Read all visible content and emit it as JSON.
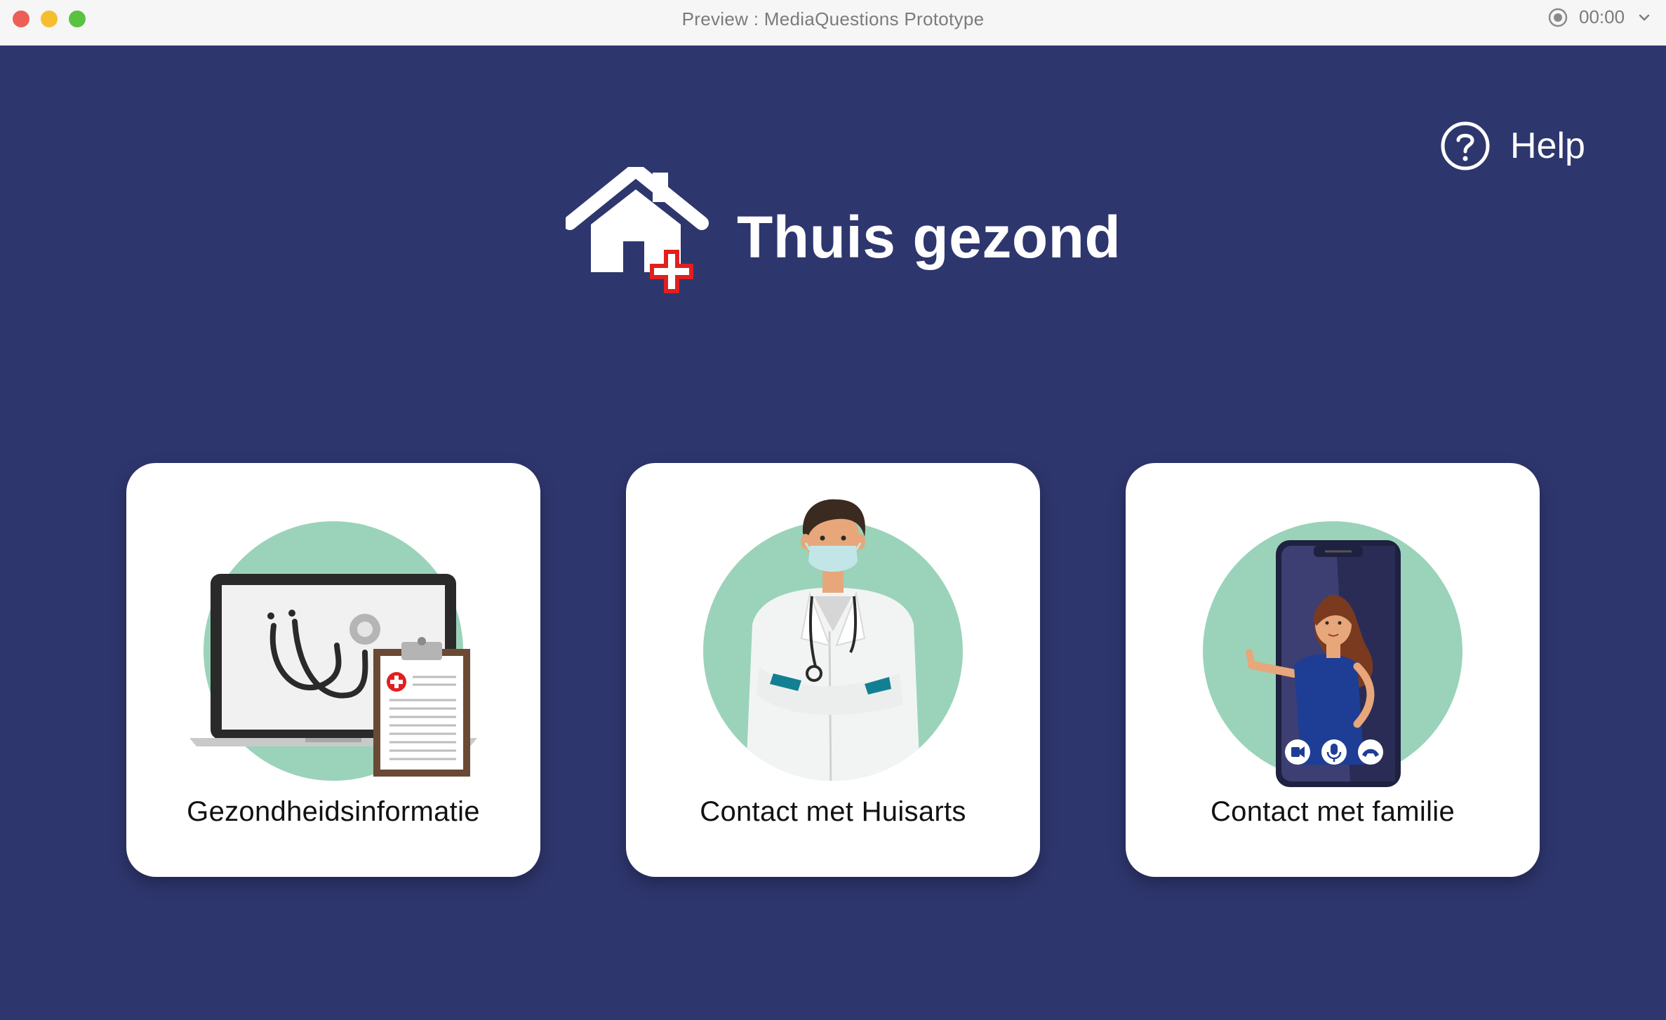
{
  "window": {
    "title": "Preview : MediaQuestions Prototype",
    "timer": "00:00"
  },
  "help": {
    "label": "Help"
  },
  "brand": {
    "title": "Thuis gezond"
  },
  "cards": [
    {
      "label": "Gezondheidsinformatie",
      "illustration": "laptop-stethoscope-clipboard"
    },
    {
      "label": "Contact met Huisarts",
      "illustration": "masked-doctor"
    },
    {
      "label": "Contact met familie",
      "illustration": "phone-video-call"
    }
  ],
  "colors": {
    "background": "#2e366e",
    "card": "#ffffff",
    "accent_circle": "#9ad3ba",
    "cross_red": "#e02020"
  }
}
